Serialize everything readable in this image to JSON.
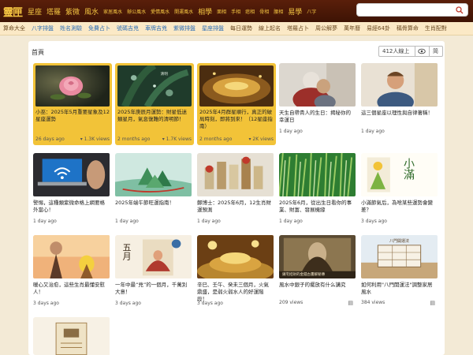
{
  "header": {
    "logo": "靈匣",
    "nav_big": [
      "星座",
      "塔羅",
      "紫微",
      "風水"
    ],
    "nav_small": [
      "家居風水",
      "辦公風水",
      "愛情風水",
      "開運風水"
    ],
    "nav_big2": [
      "相學"
    ],
    "nav_small2": [
      "面相",
      "手相",
      "痣相",
      "骨相",
      "腰相"
    ],
    "nav_big3": [
      "易學"
    ],
    "nav_small3": [
      "八字"
    ],
    "search_placeholder": ""
  },
  "subnav": {
    "items": [
      {
        "label": "算命大全",
        "blue": false
      },
      {
        "label": "八字排盤",
        "blue": true
      },
      {
        "label": "姓名測驗",
        "blue": true
      },
      {
        "label": "免費占卜",
        "blue": true
      },
      {
        "label": "號碼吉兇",
        "blue": true
      },
      {
        "label": "車牌吉兇",
        "blue": true
      },
      {
        "label": "紫微排盤",
        "blue": true
      },
      {
        "label": "星座排盤",
        "blue": true
      },
      {
        "label": "每日運勢",
        "blue": false
      },
      {
        "label": "線上起名",
        "blue": false
      },
      {
        "label": "塔羅占卜",
        "blue": false
      },
      {
        "label": "周公解夢",
        "blue": false
      },
      {
        "label": "萬年曆",
        "blue": false
      },
      {
        "label": "易經64卦",
        "blue": false
      },
      {
        "label": "稱骨算命",
        "blue": false
      },
      {
        "label": "生肖配對",
        "blue": false
      }
    ]
  },
  "panel": {
    "breadcrumb": "首頁",
    "online_count": "412人線上",
    "lang_label": "简"
  },
  "cards": [
    {
      "title": "小巫：2025年5月重要星象及12星座運勢",
      "age": "26 days ago",
      "views": "1.3K views",
      "highlight": true,
      "thumb": "rose"
    },
    {
      "title": "2025年庚辰月運勢：財星低迷類星月，氣息復難的清明節！",
      "age": "2 months ago",
      "views": "1.7K views",
      "highlight": true,
      "thumb": "leaves"
    },
    {
      "title": "2025年4月群星順行，真正的破局時刻，即將到來！（12星座指南）",
      "age": "2 months ago",
      "views": "2K views",
      "highlight": true,
      "thumb": "gold"
    },
    {
      "title": "天生自帶貴人的生日：揭秘你的幸運日",
      "age": "1 day ago",
      "views": "",
      "highlight": false,
      "thumb": "hug"
    },
    {
      "title": "這三個星座以理性與自律著稱！",
      "age": "1 day ago",
      "views": "",
      "highlight": false,
      "thumb": "man"
    },
    {
      "title": "警惕，這種類紫微命格上網要格外當心！",
      "age": "1 day ago",
      "views": "",
      "highlight": false,
      "thumb": "laptop"
    },
    {
      "title": "2025年端午節旺運指南！",
      "age": "1 day ago",
      "views": "",
      "highlight": false,
      "thumb": "zongzi"
    },
    {
      "title": "鄭博士：2025年6月，12生肖財運預測",
      "age": "1 day ago",
      "views": "",
      "highlight": false,
      "thumb": "coins"
    },
    {
      "title": "2025年6月，從出生日看你的事業、財富、發展機緣",
      "age": "1 day ago",
      "views": "",
      "highlight": false,
      "thumb": "grass"
    },
    {
      "title": "小滿節氣后，為啥某些運勢會變差？",
      "age": "3 days ago",
      "views": "",
      "highlight": false,
      "thumb": "xiaoman"
    },
    {
      "title": "暖心又治愈，這些生肖最懂安慰人！",
      "age": "3 days ago",
      "views": "",
      "highlight": false,
      "thumb": "girl"
    },
    {
      "title": "一年中最“兇”的一個月，千萬別大意！",
      "age": "3 days ago",
      "views": "",
      "highlight": false,
      "thumb": "wuyue"
    },
    {
      "title": "辛巳、壬午、癸未三個月，火氣鼎盛，是弱火弱水人的好運階段！",
      "age": "3 days ago",
      "views": "",
      "highlight": false,
      "thumb": "coinpile"
    },
    {
      "title": "風水中銀子的擺放有什么講究",
      "age": "",
      "views": "209 views",
      "highlight": false,
      "thumb": "painting"
    },
    {
      "title": "如何利用\"八門開運法\"調整家居風水",
      "age": "",
      "views": "384 views",
      "highlight": false,
      "thumb": "bagua"
    },
    {
      "title": "",
      "age": "",
      "views": "",
      "highlight": false,
      "thumb": "scroll"
    }
  ],
  "thumb_labels": {
    "xiaoman_char": "小滿",
    "wuyue_char": "五月",
    "painting_caption": "鎮宅招財的金錢古畫解秘傳",
    "bagua_caption": "八門開運法"
  }
}
